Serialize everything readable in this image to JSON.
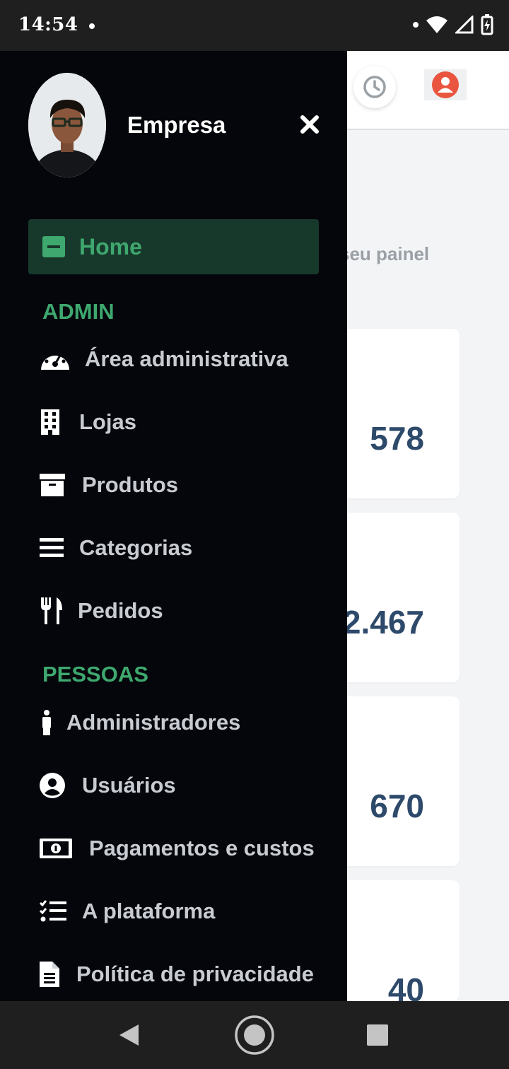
{
  "status_bar": {
    "time": "14:54"
  },
  "drawer": {
    "company": "Empresa",
    "home_label": "Home",
    "sections": [
      {
        "header": "ADMIN",
        "items": [
          {
            "label": "Área administrativa",
            "icon": "dashboard-gauge-icon"
          },
          {
            "label": "Lojas",
            "icon": "building-icon"
          },
          {
            "label": "Produtos",
            "icon": "archive-box-icon"
          },
          {
            "label": "Categorias",
            "icon": "list-bars-icon"
          },
          {
            "label": "Pedidos",
            "icon": "utensils-icon"
          }
        ]
      },
      {
        "header": "PESSOAS",
        "items": [
          {
            "label": "Administradores",
            "icon": "person-icon"
          },
          {
            "label": "Usuários",
            "icon": "user-circle-icon"
          },
          {
            "label": "Pagamentos e custos",
            "icon": "money-bill-icon"
          },
          {
            "label": "A plataforma",
            "icon": "checklist-icon"
          },
          {
            "label": "Política de privacidade",
            "icon": "document-icon"
          }
        ]
      }
    ]
  },
  "background_page": {
    "welcome_fragment": "seu painel",
    "stats": [
      "578",
      "2.467",
      "670",
      "40"
    ]
  },
  "colors": {
    "accent_green": "#3ea86f",
    "drawer_bg": "#04060b",
    "home_bg": "#17392b",
    "stat_value": "#2e4a6b",
    "profile_red": "#e9553f"
  }
}
